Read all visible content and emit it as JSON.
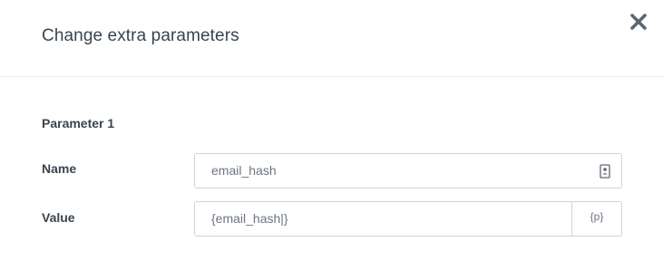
{
  "dialog": {
    "title": "Change extra parameters",
    "close_icon": "close-icon"
  },
  "parameter": {
    "section_title": "Parameter 1",
    "name_label": "Name",
    "name_value": "email_hash",
    "name_icon": "contact-card-icon",
    "value_label": "Value",
    "value_value": "{email_hash|}",
    "param_button_label": "{p}"
  }
}
